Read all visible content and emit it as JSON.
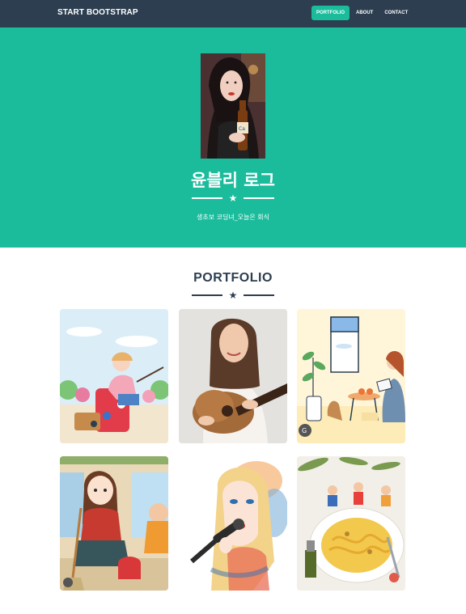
{
  "navbar": {
    "brand": "START BOOTSTRAP",
    "links": [
      {
        "label": "PORTFOLIO",
        "active": true
      },
      {
        "label": "ABOUT",
        "active": false
      },
      {
        "label": "CONTACT",
        "active": false
      }
    ]
  },
  "masthead": {
    "title": "윤블리 로그",
    "subtitle": "생초보 코딩녀_오늘은 회식",
    "icon": "star-icon"
  },
  "portfolio": {
    "heading": "PORTFOLIO",
    "icon": "star-icon",
    "items": [
      {
        "name": "travel-illustration"
      },
      {
        "name": "guitar-photo"
      },
      {
        "name": "reading-room-illustration"
      },
      {
        "name": "cleaning-girl-illustration"
      },
      {
        "name": "singer-watercolor"
      },
      {
        "name": "pasta-party-illustration"
      }
    ]
  },
  "colors": {
    "navbar": "#2c3e50",
    "primary": "#1abc9c",
    "heading": "#2c3e50"
  }
}
